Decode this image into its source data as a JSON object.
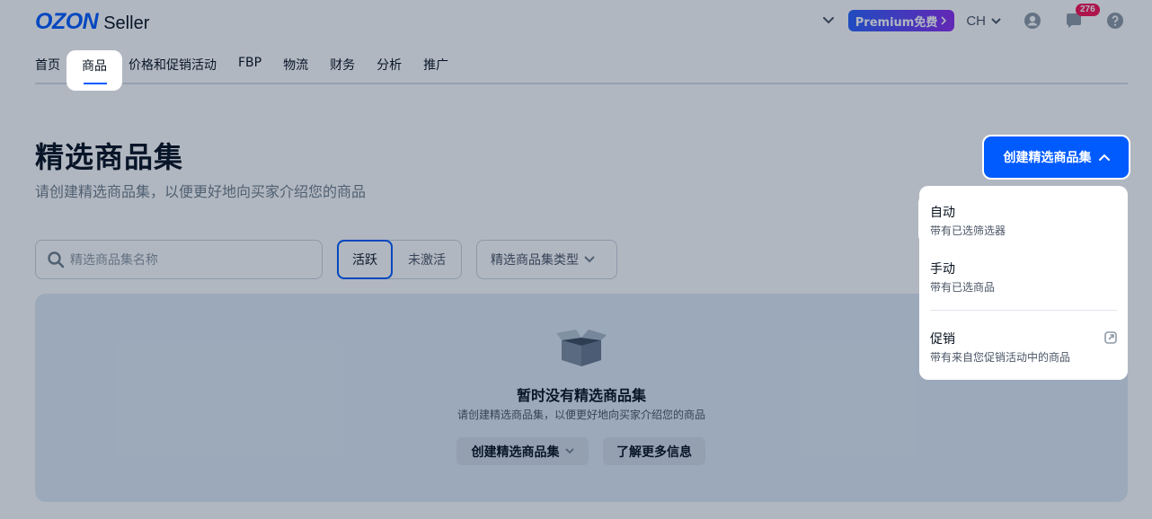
{
  "header": {
    "logo_brand": "OZON",
    "logo_product": "Seller",
    "premium_label": "Premium免费",
    "language": "CH",
    "notifications_count": "276"
  },
  "nav": {
    "items": [
      {
        "label": "首页"
      },
      {
        "label": "商品",
        "active": true
      },
      {
        "label": "价格和促销活动"
      },
      {
        "label": "FBP"
      },
      {
        "label": "物流"
      },
      {
        "label": "财务"
      },
      {
        "label": "分析"
      },
      {
        "label": "推广"
      }
    ]
  },
  "page": {
    "title": "精选商品集",
    "subtitle": "请创建精选商品集，以便更好地向买家介绍您的商品",
    "create_button": "创建精选商品集"
  },
  "filters": {
    "search_placeholder": "精选商品集名称",
    "status_active": "活跃",
    "status_inactive": "未激活",
    "type_select": "精选商品集类型"
  },
  "empty": {
    "title": "暂时没有精选商品集",
    "subtitle": "请创建精选商品集，以便更好地向买家介绍您的商品",
    "create_button": "创建精选商品集",
    "learn_more": "了解更多信息"
  },
  "menu": {
    "items": [
      {
        "title": "自动",
        "desc": "带有已选筛选器"
      },
      {
        "title": "手动",
        "desc": "带有已选商品"
      },
      {
        "title": "促销",
        "desc": "带有来自您促销活动中的商品"
      }
    ]
  },
  "colors": {
    "accent": "#005bff",
    "badge": "#f91155",
    "premium_from": "#2b61ff",
    "premium_to": "#8c2cf0"
  }
}
